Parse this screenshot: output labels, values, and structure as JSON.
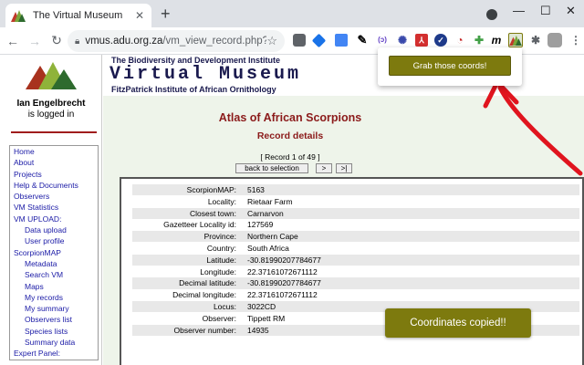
{
  "browser": {
    "tab_title": "The Virtual Museum",
    "new_tab": "+",
    "tab_close": "✕",
    "url_host": "vmus.adu.org.za",
    "url_path": "/vm_view_record.php?data...",
    "minimize": "—",
    "maximize": "☐",
    "close": "✕"
  },
  "header": {
    "institute": "The Biodiversity and Development Institute",
    "title": "Virtual Museum",
    "fitzpatrick": "FitzPatrick Institute of African Ornithology"
  },
  "user": {
    "name": "Ian Engelbrecht",
    "status": "is logged in"
  },
  "menu": [
    {
      "label": "Home",
      "type": "item"
    },
    {
      "label": "About",
      "type": "item"
    },
    {
      "label": "Projects",
      "type": "item"
    },
    {
      "label": "Help & Documents",
      "type": "item"
    },
    {
      "label": "Observers",
      "type": "item"
    },
    {
      "label": "VM Statistics",
      "type": "item"
    },
    {
      "label": "VM UPLOAD:",
      "type": "section"
    },
    {
      "label": "Data upload",
      "type": "sub"
    },
    {
      "label": "User profile",
      "type": "sub"
    },
    {
      "label": "ScorpionMAP",
      "type": "section"
    },
    {
      "label": "Metadata",
      "type": "sub"
    },
    {
      "label": "Search VM",
      "type": "sub"
    },
    {
      "label": "Maps",
      "type": "sub"
    },
    {
      "label": "My records",
      "type": "sub"
    },
    {
      "label": "My summary",
      "type": "sub"
    },
    {
      "label": "Observers list",
      "type": "sub"
    },
    {
      "label": "Species lists",
      "type": "sub"
    },
    {
      "label": "Summary data",
      "type": "sub"
    },
    {
      "label": "Expert Panel:",
      "type": "section"
    }
  ],
  "main": {
    "atlas_title": "Atlas of African Scorpions",
    "record_details": "Record details",
    "record_count": "[ Record 1 of 49 ]",
    "back_button": "back to selection",
    "next_button": ">",
    "last_button": ">|"
  },
  "fields": [
    {
      "label": "ScorpionMAP:",
      "value": "5163"
    },
    {
      "label": "Locality:",
      "value": "Rietaar Farm"
    },
    {
      "label": "Closest town:",
      "value": "Carnarvon"
    },
    {
      "label": "Gazetteer Locality id:",
      "value": "127569"
    },
    {
      "label": "Province:",
      "value": "Northern Cape"
    },
    {
      "label": "Country:",
      "value": "South Africa"
    },
    {
      "label": "Latitude:",
      "value": "-30.81990207784677"
    },
    {
      "label": "Longitude:",
      "value": "22.37161072671112"
    },
    {
      "label": "Decimal latitude:",
      "value": "-30.81990207784677"
    },
    {
      "label": "Decimal longitude:",
      "value": "22.37161072671112"
    },
    {
      "label": "Locus:",
      "value": "3022CD"
    },
    {
      "label": "Observer:",
      "value": "Tippett RM"
    },
    {
      "label": "Observer number:",
      "value": "14935"
    }
  ],
  "popup": {
    "grab_button": "Grab those coords!"
  },
  "toast": {
    "message": "Coordinates copied!!"
  },
  "colors": {
    "accent_olive": "#7d7a0e",
    "arrow_red": "#e0141e",
    "heading_red": "#8b1a1a",
    "navy": "#1a1a4e"
  }
}
